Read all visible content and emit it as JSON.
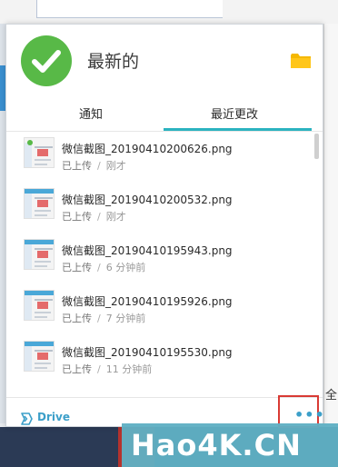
{
  "header": {
    "title": "最新的"
  },
  "tabs": [
    {
      "label": "通知",
      "active": false
    },
    {
      "label": "最近更改",
      "active": true
    }
  ],
  "files": [
    {
      "name": "微信截图_20190410200626.png",
      "status": "已上传",
      "time": "刚才"
    },
    {
      "name": "微信截图_20190410200532.png",
      "status": "已上传",
      "time": "刚才"
    },
    {
      "name": "微信截图_20190410195943.png",
      "status": "已上传",
      "time": "6 分钟前"
    },
    {
      "name": "微信截图_20190410195926.png",
      "status": "已上传",
      "time": "7 分钟前"
    },
    {
      "name": "微信截图_20190410195530.png",
      "status": "已上传",
      "time": "11 分钟前"
    }
  ],
  "footer": {
    "drive_label": "Drive",
    "more_label": "•••"
  },
  "background": {
    "right_text": "全"
  },
  "watermark": {
    "text": "Hao4K.CN"
  },
  "icons": {
    "status": "check-icon",
    "folder": "folder-icon",
    "drive": "drive-logo-icon",
    "more": "more-icon"
  },
  "colors": {
    "accent": "#2bb3c0",
    "success": "#58b947",
    "link": "#3c9fc9",
    "folder": "#f5b800",
    "highlight": "#d93a34"
  }
}
